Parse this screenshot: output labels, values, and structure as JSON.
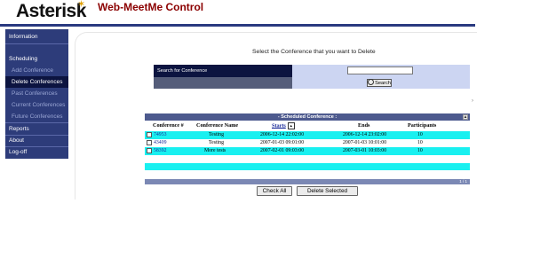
{
  "header": {
    "logo": "Asterisk",
    "title": "Web-MeetMe Control"
  },
  "sidebar": {
    "items": [
      {
        "label": "Information"
      },
      {
        "label": "Scheduling"
      },
      {
        "label": "Add Conference"
      },
      {
        "label": "Delete Conferences"
      },
      {
        "label": "Past Conferences"
      },
      {
        "label": "Current Conferences"
      },
      {
        "label": "Future Conferences"
      },
      {
        "label": "Reports"
      },
      {
        "label": "About"
      },
      {
        "label": "Log-off"
      }
    ]
  },
  "main": {
    "heading": "Select the Conference that you want to Delete",
    "search": {
      "label": "Search for Conference",
      "value": "",
      "button_label": "Search"
    },
    "panel": {
      "title": "- Scheduled Conference :",
      "columns": {
        "conf_no": "Conference #",
        "name": "Conference Name",
        "starts": "Starts",
        "ends": "Ends",
        "participants": "Participants"
      },
      "rows": [
        {
          "id": "74953",
          "name": "Testing",
          "starts": "2006-12-14 22:02:00",
          "ends": "2006-12-14 23:02:00",
          "participants": "10"
        },
        {
          "id": "43409",
          "name": "Testing",
          "starts": "2007-01-03 09:01:00",
          "ends": "2007-01-03 10:01:00",
          "participants": "10"
        },
        {
          "id": "58392",
          "name": "More tests",
          "starts": "2007-02-01 09:03:00",
          "ends": "2007-03-01 10:03:00",
          "participants": "10"
        }
      ],
      "footer": "1 / 1"
    },
    "check_all_label": "Check All",
    "delete_label": "Delete Selected"
  },
  "colors": {
    "nav_bg": "#2d3c7a",
    "nav_active": "#0c1440",
    "row_highlight": "#19f0f0",
    "title_color": "#8b0000"
  }
}
